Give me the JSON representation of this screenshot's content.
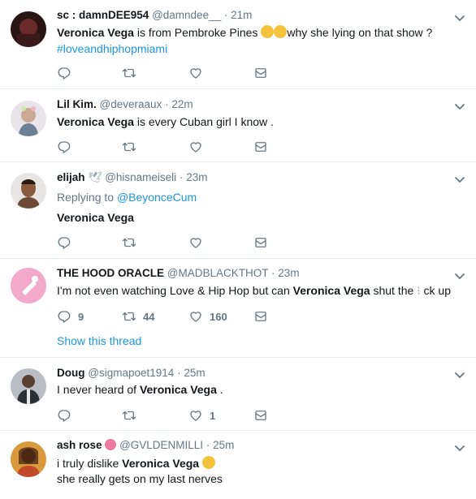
{
  "tweets": [
    {
      "name": "sc : damnDEE954",
      "handle": "@damndee__",
      "time": "21m",
      "text_a": "Veronica Vega",
      "text_b": " is from Pembroke Pines ",
      "text_c": "why she lying on that show ?",
      "hashtag": "#loveandhiphopmiami",
      "emojis": [
        "rofl-emoji",
        "rofl-emoji"
      ]
    },
    {
      "name": "Lil Kim.",
      "handle": "@deveraaux",
      "time": "22m",
      "text_a": "Veronica Vega",
      "text_b": " is every Cuban girl I know ."
    },
    {
      "name": "elijah",
      "handle": "@hisnameiseli",
      "time": "23m",
      "replying_label": "Replying to ",
      "replying_to": "@BeyonceCum",
      "text_a": "Veronica Vega",
      "name_badge": "dove-emoji"
    },
    {
      "name": "THE HOOD ORACLE",
      "handle": "@MADBLACKTHOT",
      "time": "23m",
      "text_pre": "I'm not even watching Love & Hip Hop but can ",
      "text_a": "Veronica Vega",
      "text_b": " shut the ",
      "text_c": "ck up",
      "counts": {
        "reply": "9",
        "retweet": "44",
        "like": "160"
      },
      "show_thread": "Show this thread"
    },
    {
      "name": "Doug",
      "handle": "@sigmapoet1914",
      "time": "25m",
      "text_pre": "I never heard of ",
      "text_a": "Veronica Vega",
      "text_b": " .",
      "counts": {
        "like": "1"
      }
    },
    {
      "name": "ash rose",
      "handle": "@GVLDENMILLI",
      "time": "25m",
      "text_pre": "i truly dislike ",
      "text_a": "Veronica Vega",
      "text_line2": " she really gets on my last nerves",
      "name_badge": "hibiscus-emoji",
      "emoji": "expressionless-emoji"
    }
  ],
  "colors": {
    "link": "#1b95e0",
    "muted": "#657786",
    "border": "#e6ecf0"
  }
}
